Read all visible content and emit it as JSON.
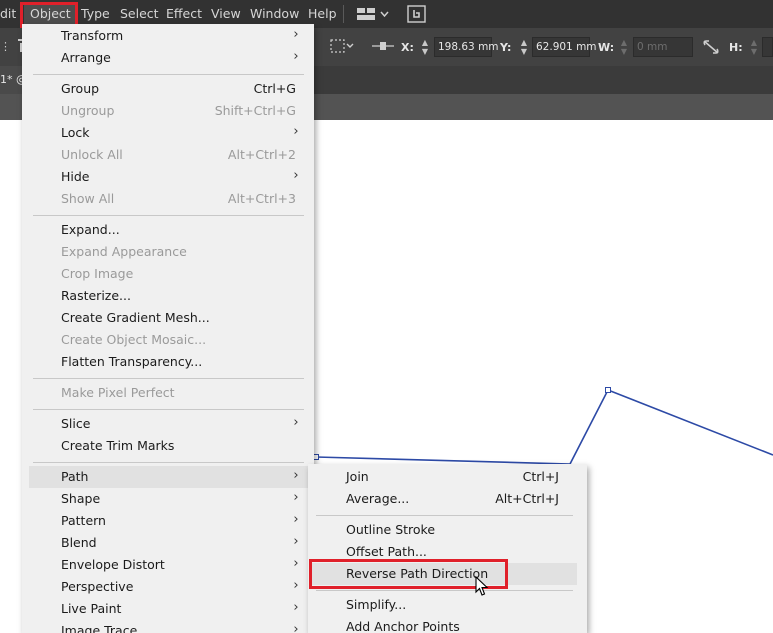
{
  "menubar": {
    "items": [
      "dit",
      "Object",
      "Type",
      "Select",
      "Effect",
      "View",
      "Window",
      "Help"
    ]
  },
  "controlbar": {
    "x_label": "X:",
    "x_value": "198.63 mm",
    "y_label": "Y:",
    "y_value": "62.901 mm",
    "w_label": "W:",
    "w_value": "0 mm",
    "h_label": "H:"
  },
  "document_tab": {
    "label": "1* @"
  },
  "object_menu": {
    "items": [
      {
        "label": "Transform",
        "submenu": true
      },
      {
        "label": "Arrange",
        "submenu": true
      },
      {
        "label": "Group",
        "shortcut": "Ctrl+G"
      },
      {
        "label": "Ungroup",
        "shortcut": "Shift+Ctrl+G",
        "disabled": true
      },
      {
        "label": "Lock",
        "submenu": true
      },
      {
        "label": "Unlock All",
        "shortcut": "Alt+Ctrl+2",
        "disabled": true
      },
      {
        "label": "Hide",
        "submenu": true
      },
      {
        "label": "Show All",
        "shortcut": "Alt+Ctrl+3",
        "disabled": true
      },
      {
        "label": "Expand..."
      },
      {
        "label": "Expand Appearance",
        "disabled": true
      },
      {
        "label": "Crop Image",
        "disabled": true
      },
      {
        "label": "Rasterize..."
      },
      {
        "label": "Create Gradient Mesh..."
      },
      {
        "label": "Create Object Mosaic...",
        "disabled": true
      },
      {
        "label": "Flatten Transparency..."
      },
      {
        "label": "Make Pixel Perfect",
        "disabled": true
      },
      {
        "label": "Slice",
        "submenu": true
      },
      {
        "label": "Create Trim Marks"
      },
      {
        "label": "Path",
        "submenu": true,
        "highlighted": true
      },
      {
        "label": "Shape",
        "submenu": true
      },
      {
        "label": "Pattern",
        "submenu": true
      },
      {
        "label": "Blend",
        "submenu": true
      },
      {
        "label": "Envelope Distort",
        "submenu": true
      },
      {
        "label": "Perspective",
        "submenu": true
      },
      {
        "label": "Live Paint",
        "submenu": true
      },
      {
        "label": "Image Trace",
        "submenu": true
      }
    ]
  },
  "path_submenu": {
    "items": [
      {
        "label": "Join",
        "shortcut": "Ctrl+J"
      },
      {
        "label": "Average...",
        "shortcut": "Alt+Ctrl+J"
      },
      {
        "label": "Outline Stroke"
      },
      {
        "label": "Offset Path..."
      },
      {
        "label": "Reverse Path Direction",
        "highlighted": true
      },
      {
        "label": "Simplify..."
      },
      {
        "label": "Add Anchor Points"
      }
    ]
  },
  "colors": {
    "menubar_bg": "#323232",
    "menu_bg": "#f0f0f0",
    "highlight_box": "#e0202a",
    "path_stroke": "#2d4aa6"
  }
}
